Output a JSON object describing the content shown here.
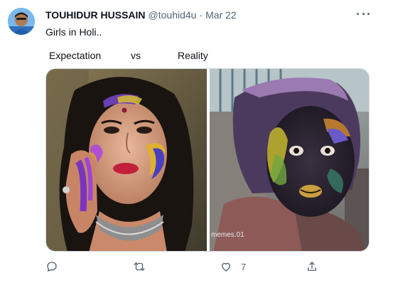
{
  "user": {
    "display_name": "TOUHIDUR HUSSAIN",
    "handle": "@touhid4u",
    "separator": "·",
    "date": "Mar 22"
  },
  "tweet": {
    "text": "Girls in Holi.."
  },
  "captions": {
    "left": "Expectation",
    "middle": "vs",
    "right": "Reality"
  },
  "image": {
    "watermark": "memes.01"
  },
  "actions": {
    "reply_icon": "reply-icon",
    "retweet_icon": "retweet-icon",
    "like_icon": "heart-icon",
    "like_count": "7",
    "share_icon": "share-icon"
  },
  "colors": {
    "text_primary": "#0f1419",
    "text_secondary": "#536471",
    "border": "#cfd9de"
  }
}
